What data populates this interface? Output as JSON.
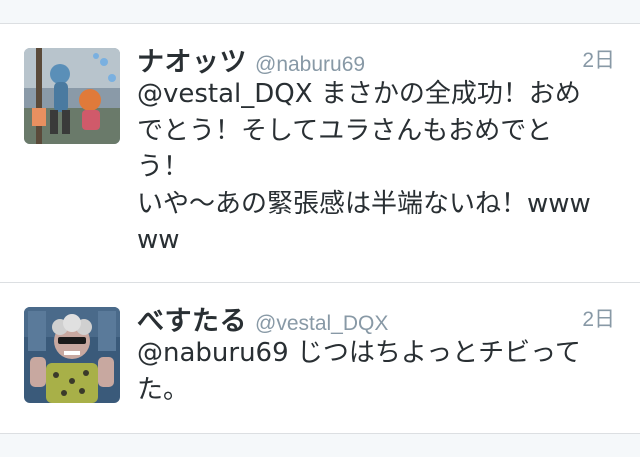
{
  "timeline": {
    "tweets": [
      {
        "display_name": "ナオッツ",
        "handle": "@naburu69",
        "time": "2日",
        "text": "@vestal_DQX まさかの全成功！おめでとう！そしてユラさんもおめでとう！\nいや〜あの緊張感は半端ないね！wwwww",
        "avatar_icon": "user-avatar-icon"
      },
      {
        "display_name": "べすたる",
        "handle": "@vestal_DQX",
        "time": "2日",
        "text": "@naburu69 じつはちよっとチビってた。",
        "avatar_icon": "user-avatar-icon"
      }
    ]
  },
  "colors": {
    "background": "#f5f8fa",
    "card": "#ffffff",
    "name": "#292f33",
    "muted": "#8899a6",
    "divider": "#dcdfe2"
  }
}
